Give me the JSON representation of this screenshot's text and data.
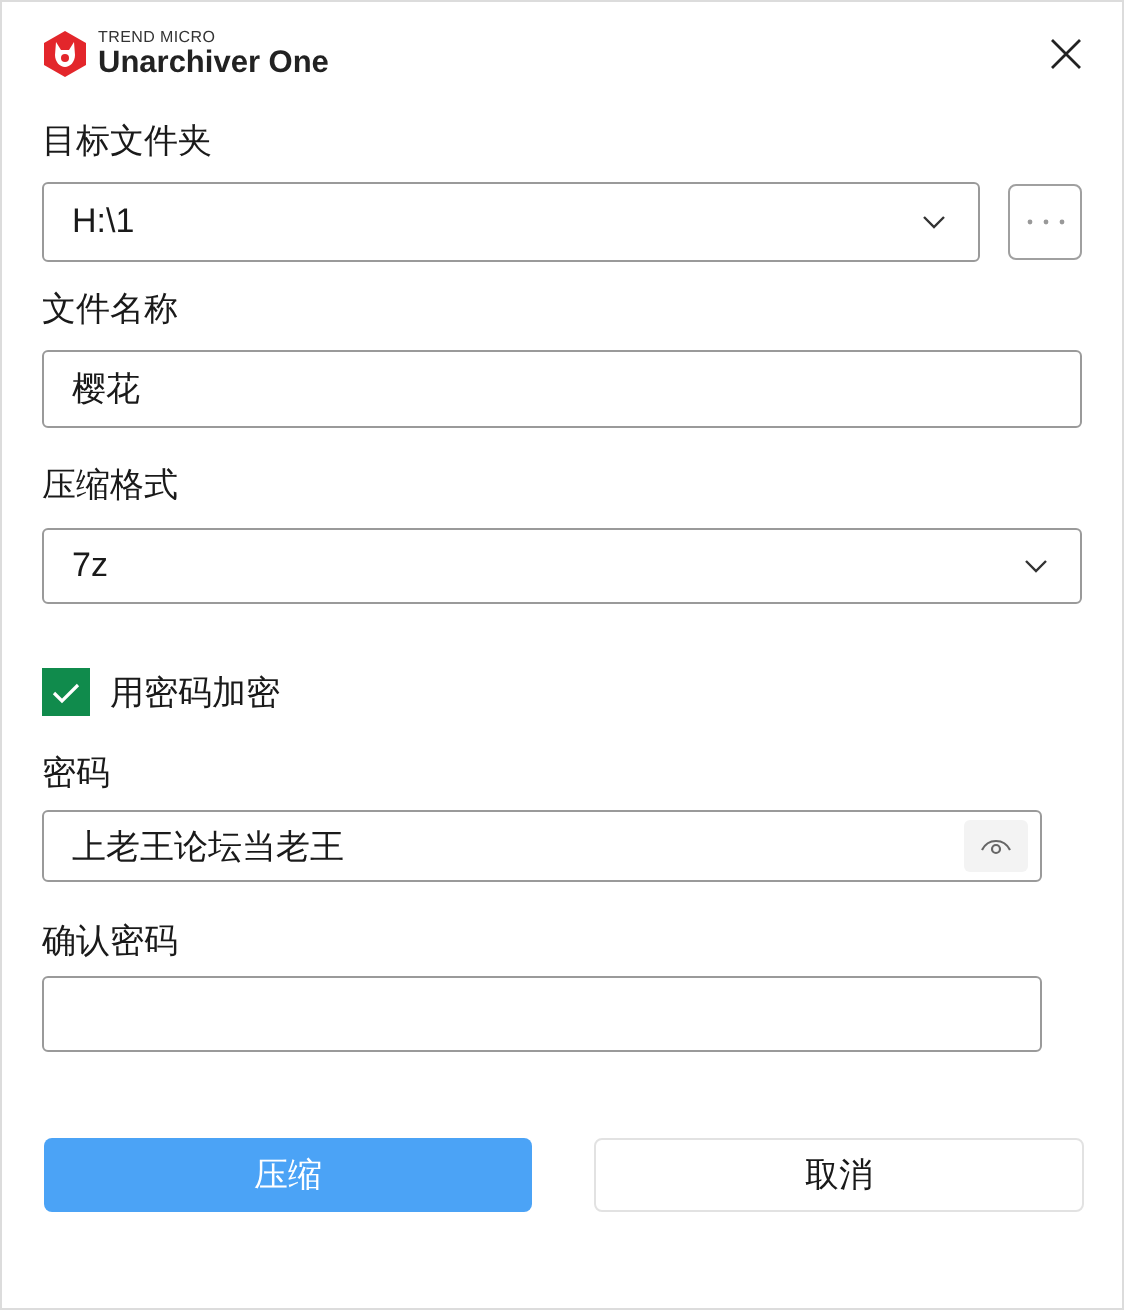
{
  "window": {
    "brand": "TREND MICRO",
    "title": "Unarchiver One"
  },
  "target_folder": {
    "label": "目标文件夹",
    "value": "H:\\1"
  },
  "file_name": {
    "label": "文件名称",
    "value": "樱花"
  },
  "format": {
    "label": "压缩格式",
    "value": "7z"
  },
  "encrypt": {
    "label": "用密码加密",
    "checked": true
  },
  "password": {
    "label": "密码",
    "value": "上老王论坛当老王"
  },
  "confirm_password": {
    "label": "确认密码"
  },
  "buttons": [
    {
      "label": "压缩",
      "kind": "primary"
    },
    {
      "label": "取消",
      "kind": "secondary"
    }
  ]
}
